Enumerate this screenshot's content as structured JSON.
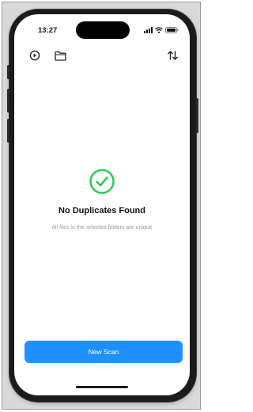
{
  "status_bar": {
    "time": "13:27"
  },
  "toolbar": {
    "icons": [
      "history-icon",
      "folder-icon",
      "sort-icon"
    ]
  },
  "empty_state": {
    "icon": "checkmark-circle-icon",
    "title": "No Duplicates Found",
    "subtitle": "All files in the selected folders are unique"
  },
  "actions": {
    "new_scan_label": "New Scan"
  },
  "colors": {
    "accent": "#1e90ff",
    "success": "#34c759"
  }
}
